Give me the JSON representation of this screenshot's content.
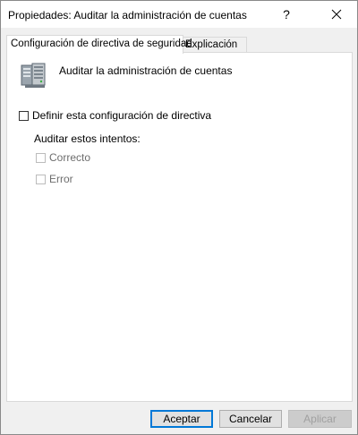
{
  "window": {
    "title": "Propiedades: Auditar la administración de cuentas",
    "help_label": "?"
  },
  "tabs": [
    {
      "label": "Configuración de directiva de seguridad",
      "active": true
    },
    {
      "label": "Explicación",
      "active": false
    }
  ],
  "policy": {
    "icon": "server-policy-icon",
    "name": "Auditar la administración de cuentas"
  },
  "settings": {
    "define_label": "Definir esta configuración de directiva",
    "define_checked": false,
    "audit_label": "Auditar estos intentos:",
    "success_label": "Correcto",
    "success_checked": false,
    "failure_label": "Error",
    "failure_checked": false
  },
  "buttons": {
    "accept": "Aceptar",
    "cancel": "Cancelar",
    "apply": "Aplicar"
  },
  "colors": {
    "accent": "#0078d7",
    "disabled_text": "#6d6d6d"
  }
}
